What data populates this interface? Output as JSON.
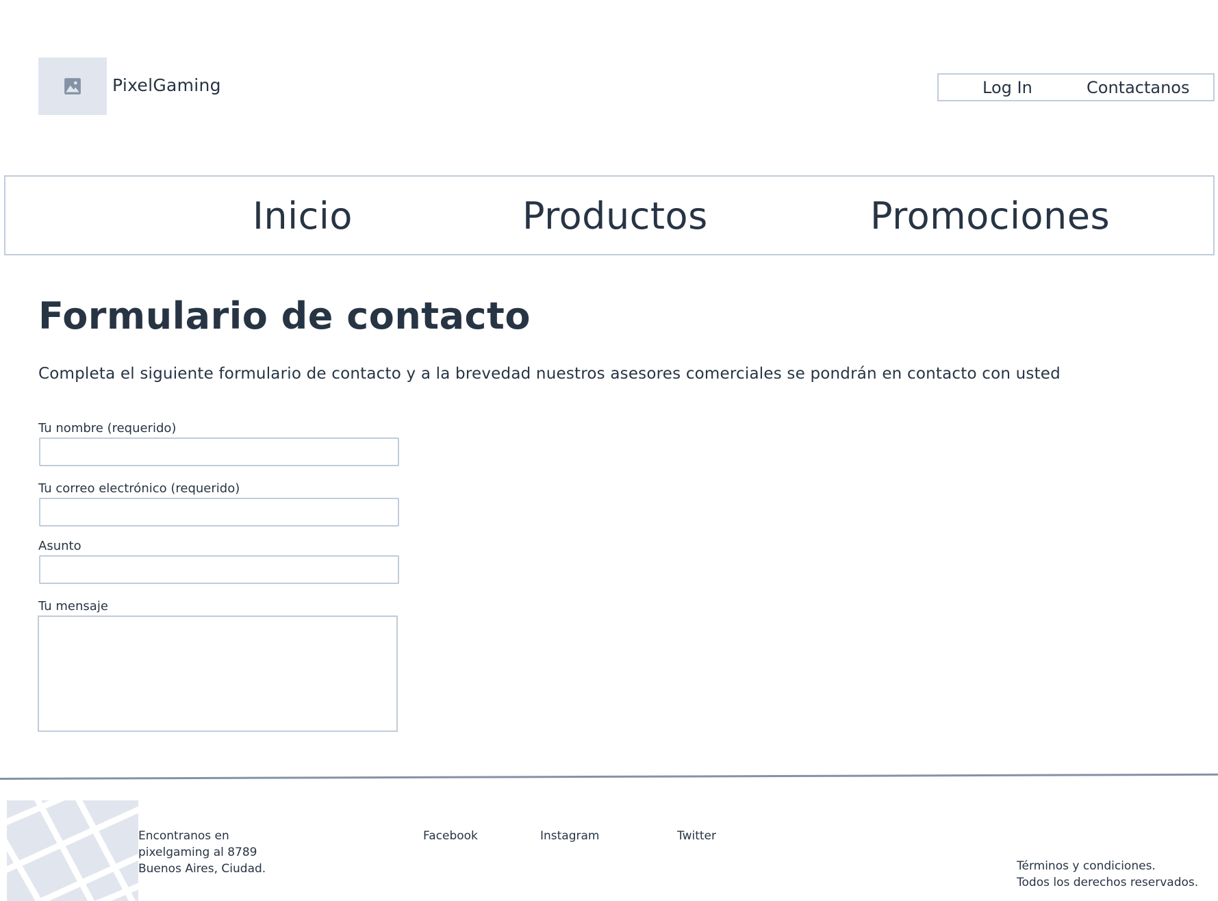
{
  "header": {
    "brand_name": "PixelGaming",
    "login_label": "Log In",
    "contact_label": "Contactanos"
  },
  "nav": {
    "items": [
      {
        "label": "Inicio"
      },
      {
        "label": "Productos"
      },
      {
        "label": "Promociones"
      }
    ]
  },
  "main": {
    "title": "Formulario de contacto",
    "intro": "Completa el siguiente formulario de contacto y a la brevedad nuestros asesores comerciales se pondrán en contacto con usted",
    "fields": {
      "name_label": "Tu nombre (requerido)",
      "name_value": "",
      "email_label": "Tu correo electrónico (requerido)",
      "email_value": "",
      "subject_label": "Asunto",
      "subject_value": "",
      "message_label": "Tu mensaje",
      "message_value": ""
    }
  },
  "footer": {
    "address": [
      "Encontranos en",
      "pixelgaming al 8789",
      "Buenos Aires, Ciudad."
    ],
    "social": [
      {
        "label": "Facebook"
      },
      {
        "label": "Instagram"
      },
      {
        "label": "Twitter"
      }
    ],
    "legal": [
      "Términos y condiciones.",
      "Todos los derechos reservados."
    ]
  },
  "colors": {
    "text": "#273444",
    "border": "#c0ccda",
    "placeholder_fill": "#e1e6ee",
    "rule": "#8492a6"
  },
  "icons": {
    "logo": "image-placeholder-icon",
    "map": "map-placeholder-icon"
  }
}
